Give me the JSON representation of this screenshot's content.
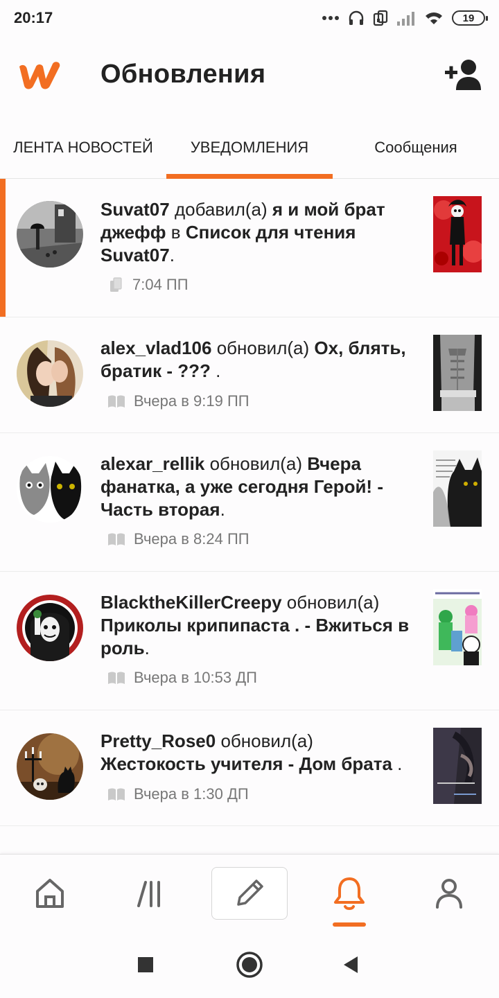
{
  "status_bar": {
    "time": "20:17",
    "battery": "19",
    "icons": [
      "more-dots-icon",
      "headphones-icon",
      "dual-sim-icon",
      "signal-icon",
      "wifi-icon",
      "battery-icon"
    ]
  },
  "header": {
    "title": "Обновления",
    "logo": "wattpad-logo",
    "action_icon": "add-user-icon"
  },
  "tabs": [
    {
      "label": "ЛЕНТА НОВОСТЕЙ",
      "active": false
    },
    {
      "label": "УВЕДОМЛЕНИЯ",
      "active": true
    },
    {
      "label": "Сообщения",
      "active": false
    }
  ],
  "notifications": [
    {
      "user": "Suvat07",
      "action": "добавил(а)",
      "story": "я и мой брат джефф",
      "connector": "в",
      "target": "Список для чтения Suvat07",
      "end": ".",
      "time": "7:04 ПП",
      "icon": "copy-icon",
      "unread": true
    },
    {
      "user": "alex_vlad106",
      "action": "обновил(а)",
      "story": "Ох, блять, братик - ???",
      "end": " .",
      "time": "Вчера в 9:19 ПП",
      "icon": "book-icon"
    },
    {
      "user": "alexar_rellik",
      "action": "обновил(а)",
      "story": "Вчера фанатка, а уже сегодня Герой! - Часть вторая",
      "end": ".",
      "time": "Вчера в 8:24 ПП",
      "icon": "book-icon"
    },
    {
      "user": "BlacktheKillerCreepy",
      "action": "обновил(а)",
      "story": "Приколы крипипаста . - Вжиться в роль",
      "end": ".",
      "time": "Вчера в 10:53 ДП",
      "icon": "book-icon"
    },
    {
      "user": "Pretty_Rose0",
      "action": "обновил(а)",
      "story": "Жестокость учителя - Дом брата",
      "end": " .",
      "time": "Вчера в 1:30 ДП",
      "icon": "book-icon"
    }
  ],
  "bottom_nav": [
    {
      "name": "home-icon"
    },
    {
      "name": "library-icon"
    },
    {
      "name": "write-icon"
    },
    {
      "name": "notifications-bell-icon",
      "active": true
    },
    {
      "name": "profile-icon"
    }
  ],
  "colors": {
    "accent": "#f26e22",
    "text": "#222222",
    "muted": "#777777"
  }
}
